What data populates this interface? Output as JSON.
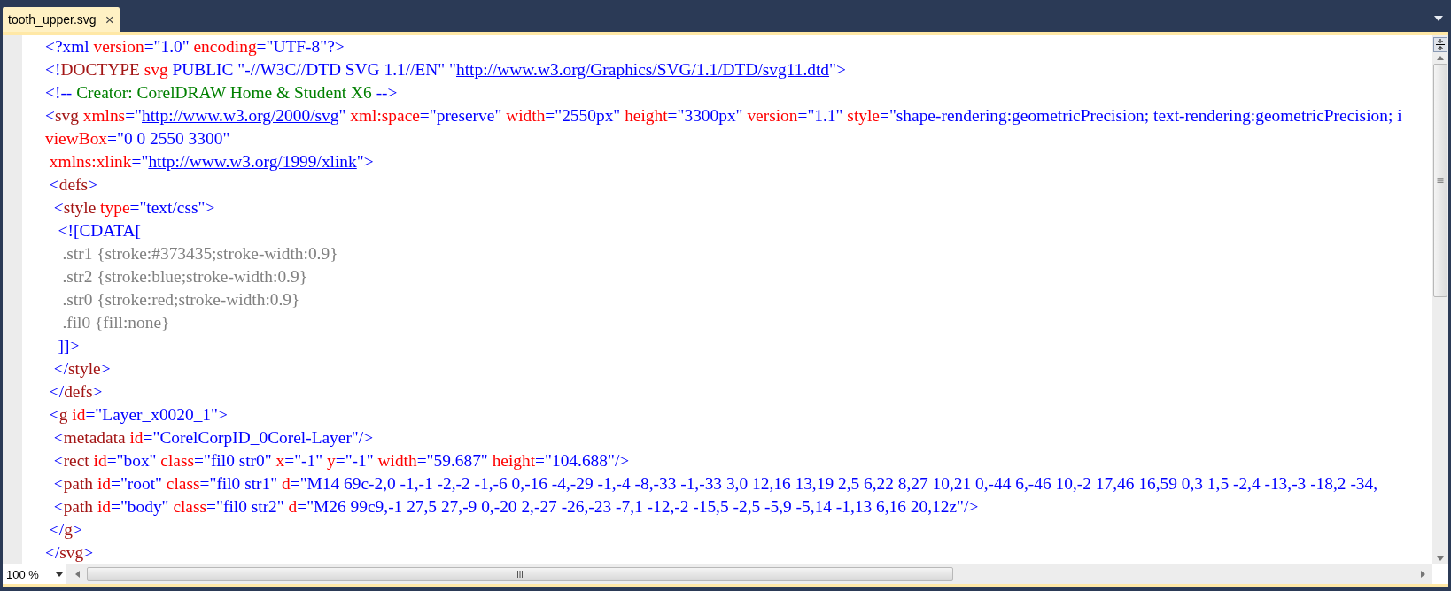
{
  "tabs": [
    {
      "label": "tooth_upper.svg",
      "selected": true,
      "close": "×"
    }
  ],
  "code_lines": [
    [
      {
        "kind": "markup",
        "text": "<?xml "
      },
      {
        "kind": "attribute",
        "text": "version"
      },
      {
        "kind": "markup",
        "text": "=\"1.0\" "
      },
      {
        "kind": "attribute",
        "text": "encoding"
      },
      {
        "kind": "markup",
        "text": "=\"UTF-8\"?>"
      }
    ],
    [
      {
        "kind": "markup",
        "text": "<!"
      },
      {
        "kind": "element",
        "text": "DOCTYPE"
      },
      {
        "kind": "attribute",
        "text": " svg"
      },
      {
        "kind": "markup",
        "text": " PUBLIC \"-//W3C//DTD SVG 1.1//EN\" \""
      },
      {
        "kind": "link",
        "text": "http://www.w3.org/Graphics/SVG/1.1/DTD/svg11.dtd"
      },
      {
        "kind": "markup",
        "text": "\">"
      }
    ],
    [
      {
        "kind": "markup",
        "text": "<!--"
      },
      {
        "kind": "comment",
        "text": " Creator: CorelDRAW Home & Student X6 "
      },
      {
        "kind": "markup",
        "text": "-->"
      }
    ],
    [
      {
        "kind": "markup",
        "text": "<"
      },
      {
        "kind": "element",
        "text": "svg"
      },
      {
        "kind": "attribute",
        "text": " xmlns"
      },
      {
        "kind": "markup",
        "text": "=\""
      },
      {
        "kind": "link",
        "text": "http://www.w3.org/2000/svg"
      },
      {
        "kind": "markup",
        "text": "\" "
      },
      {
        "kind": "attribute",
        "text": "xml:space"
      },
      {
        "kind": "markup",
        "text": "=\"preserve\" "
      },
      {
        "kind": "attribute",
        "text": "width"
      },
      {
        "kind": "markup",
        "text": "=\"2550px\" "
      },
      {
        "kind": "attribute",
        "text": "height"
      },
      {
        "kind": "markup",
        "text": "=\"3300px\" "
      },
      {
        "kind": "attribute",
        "text": "version"
      },
      {
        "kind": "markup",
        "text": "=\"1.1\" "
      },
      {
        "kind": "attribute",
        "text": "style"
      },
      {
        "kind": "markup",
        "text": "=\"shape-rendering:geometricPrecision; text-rendering:geometricPrecision; i"
      }
    ],
    [
      {
        "kind": "attribute",
        "text": "viewBox"
      },
      {
        "kind": "markup",
        "text": "=\"0 0 2550 3300\""
      }
    ],
    [
      {
        "kind": "attribute",
        "text": " xmlns:xlink"
      },
      {
        "kind": "markup",
        "text": "=\""
      },
      {
        "kind": "link",
        "text": "http://www.w3.org/1999/xlink"
      },
      {
        "kind": "markup",
        "text": "\">"
      }
    ],
    [
      {
        "kind": "markup",
        "text": " <"
      },
      {
        "kind": "element",
        "text": "defs"
      },
      {
        "kind": "markup",
        "text": ">"
      }
    ],
    [
      {
        "kind": "markup",
        "text": "  <"
      },
      {
        "kind": "element",
        "text": "style"
      },
      {
        "kind": "attribute",
        "text": " type"
      },
      {
        "kind": "markup",
        "text": "=\"text/css\">"
      }
    ],
    [
      {
        "kind": "markup",
        "text": "   <![CDATA["
      }
    ],
    [
      {
        "kind": "css",
        "text": "    .str1 {stroke:#373435;stroke-width:0.9}"
      }
    ],
    [
      {
        "kind": "css",
        "text": "    .str2 {stroke:blue;stroke-width:0.9}"
      }
    ],
    [
      {
        "kind": "css",
        "text": "    .str0 {stroke:red;stroke-width:0.9}"
      }
    ],
    [
      {
        "kind": "css",
        "text": "    .fil0 {fill:none}"
      }
    ],
    [
      {
        "kind": "markup",
        "text": "   ]]>"
      }
    ],
    [
      {
        "kind": "markup",
        "text": "  </"
      },
      {
        "kind": "element",
        "text": "style"
      },
      {
        "kind": "markup",
        "text": ">"
      }
    ],
    [
      {
        "kind": "markup",
        "text": " </"
      },
      {
        "kind": "element",
        "text": "defs"
      },
      {
        "kind": "markup",
        "text": ">"
      }
    ],
    [
      {
        "kind": "markup",
        "text": " <"
      },
      {
        "kind": "element",
        "text": "g"
      },
      {
        "kind": "attribute",
        "text": " id"
      },
      {
        "kind": "markup",
        "text": "=\"Layer_x0020_1\">"
      }
    ],
    [
      {
        "kind": "markup",
        "text": "  <"
      },
      {
        "kind": "element",
        "text": "metadata"
      },
      {
        "kind": "attribute",
        "text": " id"
      },
      {
        "kind": "markup",
        "text": "=\"CorelCorpID_0Corel-Layer\"/>"
      }
    ],
    [
      {
        "kind": "markup",
        "text": "  <"
      },
      {
        "kind": "element",
        "text": "rect"
      },
      {
        "kind": "attribute",
        "text": " id"
      },
      {
        "kind": "markup",
        "text": "=\"box\" "
      },
      {
        "kind": "attribute",
        "text": "class"
      },
      {
        "kind": "markup",
        "text": "=\"fil0 str0\" "
      },
      {
        "kind": "attribute",
        "text": "x"
      },
      {
        "kind": "markup",
        "text": "=\"-1\" "
      },
      {
        "kind": "attribute",
        "text": "y"
      },
      {
        "kind": "markup",
        "text": "=\"-1\" "
      },
      {
        "kind": "attribute",
        "text": "width"
      },
      {
        "kind": "markup",
        "text": "=\"59.687\" "
      },
      {
        "kind": "attribute",
        "text": "height"
      },
      {
        "kind": "markup",
        "text": "=\"104.688\"/>"
      }
    ],
    [
      {
        "kind": "markup",
        "text": "  <"
      },
      {
        "kind": "element",
        "text": "path"
      },
      {
        "kind": "attribute",
        "text": " id"
      },
      {
        "kind": "markup",
        "text": "=\"root\" "
      },
      {
        "kind": "attribute",
        "text": "class"
      },
      {
        "kind": "markup",
        "text": "=\"fil0 str1\" "
      },
      {
        "kind": "attribute",
        "text": "d"
      },
      {
        "kind": "markup",
        "text": "=\"M14 69c-2,0 -1,-1 -2,-2 -1,-6 0,-16 -4,-29 -1,-4 -8,-33 -1,-33 3,0 12,16 13,19 2,5 6,22 8,27 10,21 0,-44 6,-46 10,-2 17,46 16,59 0,3 1,5 -2,4 -13,-3 -18,2 -34,"
      }
    ],
    [
      {
        "kind": "markup",
        "text": "  <"
      },
      {
        "kind": "element",
        "text": "path"
      },
      {
        "kind": "attribute",
        "text": " id"
      },
      {
        "kind": "markup",
        "text": "=\"body\" "
      },
      {
        "kind": "attribute",
        "text": "class"
      },
      {
        "kind": "markup",
        "text": "=\"fil0 str2\" "
      },
      {
        "kind": "attribute",
        "text": "d"
      },
      {
        "kind": "markup",
        "text": "=\"M26 99c9,-1 27,5 27,-9 0,-20 2,-27 -26,-23 -7,1 -12,-2 -15,5 -2,5 -5,9 -5,14 -1,13 6,16 20,12z\"/>"
      }
    ],
    [
      {
        "kind": "markup",
        "text": " </"
      },
      {
        "kind": "element",
        "text": "g"
      },
      {
        "kind": "markup",
        "text": ">"
      }
    ],
    [
      {
        "kind": "markup",
        "text": "</"
      },
      {
        "kind": "element",
        "text": "svg"
      },
      {
        "kind": "markup",
        "text": ">"
      }
    ]
  ],
  "zoom": {
    "value": "100 %"
  }
}
